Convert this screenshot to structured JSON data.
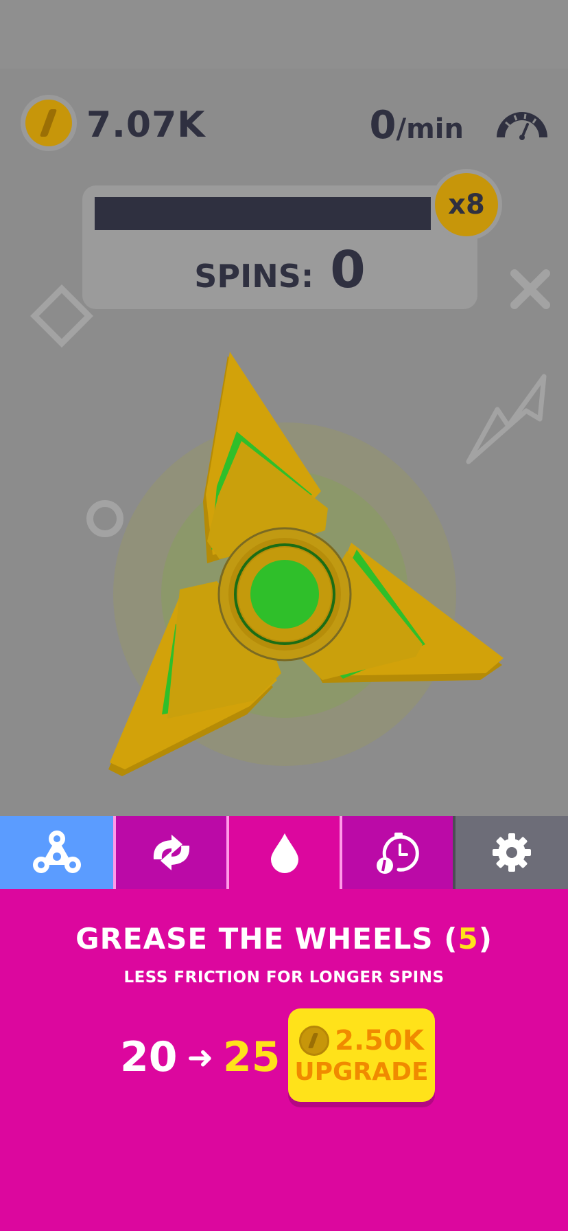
{
  "hud": {
    "coins": "7.07K",
    "rate_value": "0",
    "rate_unit": "/min"
  },
  "progress": {
    "multiplier": "x8",
    "fill_fraction": 1.0,
    "spins_label": "SPINS:",
    "spins_value": "0"
  },
  "tabs": [
    {
      "name": "spinners",
      "icon": "fidget-spinner-icon",
      "active": false
    },
    {
      "name": "auto-spin",
      "icon": "refresh-arrows-icon",
      "active": false
    },
    {
      "name": "grease",
      "icon": "oil-drop-icon",
      "active": true
    },
    {
      "name": "time",
      "icon": "stopwatch-coin-icon",
      "active": false
    },
    {
      "name": "settings",
      "icon": "gear-icon",
      "active": false
    }
  ],
  "upgrade": {
    "title": "GREASE THE WHEELS (",
    "level": "5",
    "title_end": ")",
    "description": "LESS FRICTION FOR LONGER SPINS",
    "current_value": "20",
    "next_value": "25",
    "cost": "2.50K",
    "button_label": "UPGRADE"
  },
  "colors": {
    "game_background": "#8c8c8c",
    "panel_pink": "#dc079e",
    "tab_blue": "#5b9cff",
    "tab_purple": "#bb0aa7",
    "tab_gray": "#6d6d78",
    "highlight_yellow": "#ffe21a",
    "coin_gold": "#c7960a",
    "dark_text": "#2f3040"
  }
}
